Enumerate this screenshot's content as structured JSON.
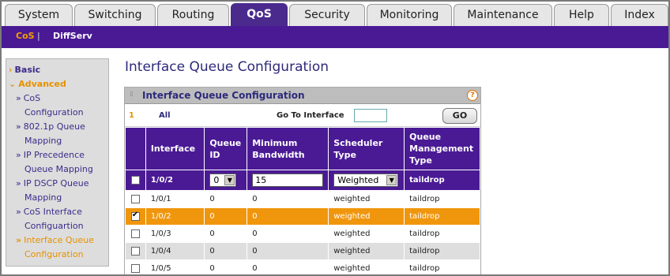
{
  "top_tabs": [
    {
      "label": "System",
      "active": false
    },
    {
      "label": "Switching",
      "active": false
    },
    {
      "label": "Routing",
      "active": false
    },
    {
      "label": "QoS",
      "active": true
    },
    {
      "label": "Security",
      "active": false
    },
    {
      "label": "Monitoring",
      "active": false
    },
    {
      "label": "Maintenance",
      "active": false
    },
    {
      "label": "Help",
      "active": false
    },
    {
      "label": "Index",
      "active": false
    }
  ],
  "sub_nav": {
    "cos": "CoS",
    "separator": "|",
    "diffserv": "DiffServ"
  },
  "sidebar": {
    "basic": "Basic",
    "advanced": "Advanced",
    "items": [
      {
        "line1": "CoS",
        "line2": "Configuration"
      },
      {
        "line1": "802.1p Queue",
        "line2": "Mapping"
      },
      {
        "line1": "IP Precedence",
        "line2": "Queue Mapping"
      },
      {
        "line1": "IP DSCP Queue",
        "line2": "Mapping"
      },
      {
        "line1": "CoS Interface",
        "line2": "Configuartion"
      },
      {
        "line1": "Interface Queue",
        "line2": "Configuration"
      }
    ]
  },
  "page_title": "Interface Queue Configuration",
  "panel": {
    "title": "Interface Queue Configuration",
    "help_glyph": "?",
    "pager_num": "1",
    "pager_all": "All",
    "goto_label": "Go To Interface",
    "goto_value": "",
    "go_button": "GO"
  },
  "table": {
    "headers": [
      "Interface",
      "Queue ID",
      "Minimum Bandwidth",
      "Scheduler Type",
      "Queue Management Type"
    ],
    "header_lines": {
      "queue_id": [
        "Queue",
        "ID"
      ],
      "min_bw": [
        "Minimum",
        "Bandwidth"
      ],
      "sched": [
        "Scheduler",
        "Type"
      ],
      "qmt": [
        "Queue",
        "Management",
        "Type"
      ]
    },
    "edit_row": {
      "interface": "1/0/2",
      "queue_id": "0",
      "min_bandwidth": "15",
      "scheduler": "Weighted",
      "queue_mgmt": "taildrop"
    },
    "rows": [
      {
        "interface": "1/0/1",
        "queue_id": "0",
        "min_bandwidth": "0",
        "scheduler": "weighted",
        "queue_mgmt": "taildrop",
        "checked": false,
        "style": "white"
      },
      {
        "interface": "1/0/2",
        "queue_id": "0",
        "min_bandwidth": "0",
        "scheduler": "weighted",
        "queue_mgmt": "taildrop",
        "checked": true,
        "style": "orange"
      },
      {
        "interface": "1/0/3",
        "queue_id": "0",
        "min_bandwidth": "0",
        "scheduler": "weighted",
        "queue_mgmt": "taildrop",
        "checked": false,
        "style": "white"
      },
      {
        "interface": "1/0/4",
        "queue_id": "0",
        "min_bandwidth": "0",
        "scheduler": "weighted",
        "queue_mgmt": "taildrop",
        "checked": false,
        "style": "grey"
      },
      {
        "interface": "1/0/5",
        "queue_id": "0",
        "min_bandwidth": "0",
        "scheduler": "weighted",
        "queue_mgmt": "taildrop",
        "checked": false,
        "style": "white"
      }
    ]
  },
  "colors": {
    "brand_purple": "#4a1a95",
    "accent_orange": "#f0960d",
    "title_blue": "#2c2a7a"
  }
}
